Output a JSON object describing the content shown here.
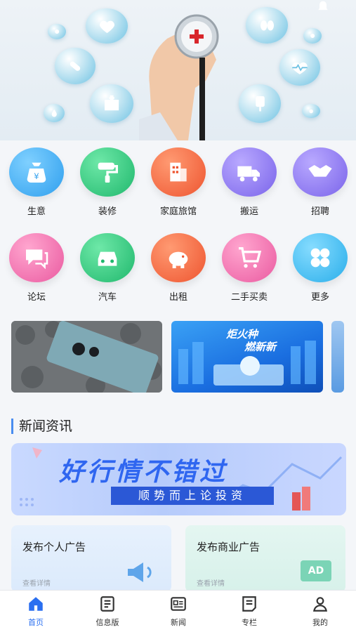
{
  "hero": {
    "bubbles": [
      "heart-icon",
      "pill-icon",
      "hospital-icon",
      "kidney-icon",
      "heart-rate-icon",
      "iv-bag-icon",
      "blood-drop-icon",
      "lungs-icon",
      "pills-icon"
    ],
    "image": "doctor-hand-with-stethoscope"
  },
  "grid": {
    "row1": [
      {
        "label": "生意",
        "icon": "money-bag-icon",
        "color": "#3aa8ef"
      },
      {
        "label": "装修",
        "icon": "paint-roller-icon",
        "color": "#27c27a"
      },
      {
        "label": "家庭旅馆",
        "icon": "building-icon",
        "color": "#f2633a"
      },
      {
        "label": "搬运",
        "icon": "truck-icon",
        "color": "#8a74ef"
      },
      {
        "label": "招聘",
        "icon": "handshake-icon",
        "color": "#8b78ee"
      }
    ],
    "row2": [
      {
        "label": "论坛",
        "icon": "chat-icon",
        "color": "#ef6aa9"
      },
      {
        "label": "汽车",
        "icon": "car-icon",
        "color": "#26c17b"
      },
      {
        "label": "出租",
        "icon": "piggy-bank-icon",
        "color": "#f2593b"
      },
      {
        "label": "二手买卖",
        "icon": "cart-icon",
        "color": "#ef73ad"
      },
      {
        "label": "更多",
        "icon": "more-icon",
        "color": "#3bb7ef"
      }
    ]
  },
  "banners": {
    "b2_title_line1": "炬火种",
    "b2_title_line2": "燃新新"
  },
  "news": {
    "section_title": "新闻资讯",
    "banner_main": "好行情不错过",
    "banner_sub": "顺势而上论投资"
  },
  "cards": [
    {
      "title": "发布个人广告",
      "sub": "查看详情",
      "icon": "megaphone-icon"
    },
    {
      "title": "发布商业广告",
      "sub": "查看详情",
      "icon": "ad-icon",
      "badge": "AD"
    }
  ],
  "tabbar": [
    {
      "label": "首页",
      "icon": "home-icon",
      "active": true
    },
    {
      "label": "信息版",
      "icon": "info-board-icon"
    },
    {
      "label": "新闻",
      "icon": "news-icon"
    },
    {
      "label": "专栏",
      "icon": "column-icon"
    },
    {
      "label": "我的",
      "icon": "profile-icon"
    }
  ],
  "colors": {
    "accent": "#2a6ff0"
  }
}
